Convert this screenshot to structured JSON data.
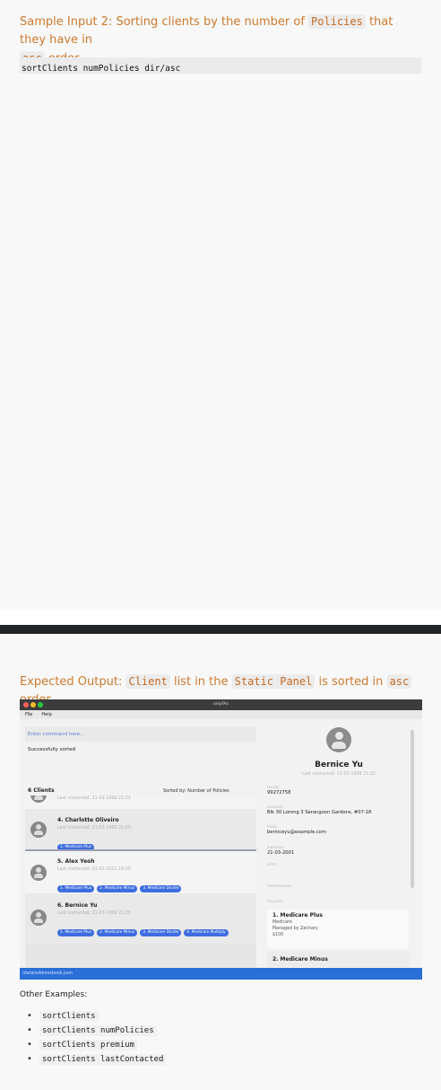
{
  "section1": {
    "prefix": "Sample Input 2: Sorting clients by the number of ",
    "code1": "Policies",
    "mid": " that they have in",
    "code2": "asc",
    "suffix": " order",
    "command": "sortClients numPolicies dir/asc"
  },
  "section2": {
    "prefix": "Expected Output: ",
    "code1": "Client",
    "mid1": " list in the ",
    "code2": "Static Panel",
    "mid2": " is sorted in ",
    "code3": "asc",
    "suffix": " order"
  },
  "app": {
    "title": "onlyFAs",
    "menu": [
      "File",
      "Help"
    ],
    "command_placeholder": "Enter command here...",
    "result": "Successfully sorted",
    "clients_heading": "6 Clients",
    "sorted_by": "Sorted by: Number of Policies",
    "clients": [
      {
        "name": "",
        "last": "Last contacted: 21-03-1999 21:03",
        "tags": []
      },
      {
        "name": "4. Charlotte Oliveiro",
        "last": "Last contacted: 21-03-1999 21:03",
        "tags": [
          "1. Medicare Plus"
        ]
      },
      {
        "name": "5. Alex Yeoh",
        "last": "Last contacted: 01-01-2022 10:00",
        "tags": [
          "1. Medicare Plus",
          "2. Medicare Minus",
          "3. Medicare Divide"
        ]
      },
      {
        "name": "6. Bernice Yu",
        "last": "Last contacted: 21-03-1999 21:03",
        "tags": [
          "1. Medicare Plus",
          "2. Medicare Minus",
          "3. Medicare Divide",
          "4. Medicare Multiply"
        ]
      }
    ],
    "detail": {
      "name": "Bernice Yu",
      "last": "Last contacted: 21-03-1999 21:03",
      "phone_label": "PHONE",
      "phone": "99272758",
      "address_label": "ADDRESS",
      "address": "Blk 30 Lorong 3 Serangoon Gardens, #07-18",
      "email_label": "EMAIL",
      "email": "berniceyu@example.com",
      "birthday_label": "BIRTHDAY",
      "birthday": "21-03-2001",
      "note_label": "NOTE",
      "preferences_label": "PREFERENCES",
      "policies_label": "POLICIES",
      "policies": [
        {
          "name": "1. Medicare Plus",
          "company": "Medicare",
          "managed": "Managed by Zechary",
          "premium": "$100"
        },
        {
          "name": "2. Medicare Minus"
        }
      ]
    },
    "status": "/data/addressbook.json"
  },
  "other_heading": "Other Examples:",
  "examples": [
    "sortClients",
    "sortClients numPolicies",
    "sortClients premium",
    "sortClients lastContacted"
  ],
  "colors": {
    "accent": "#cc7a2e",
    "tag": "#3d6de0",
    "status": "#2a6ed7"
  }
}
